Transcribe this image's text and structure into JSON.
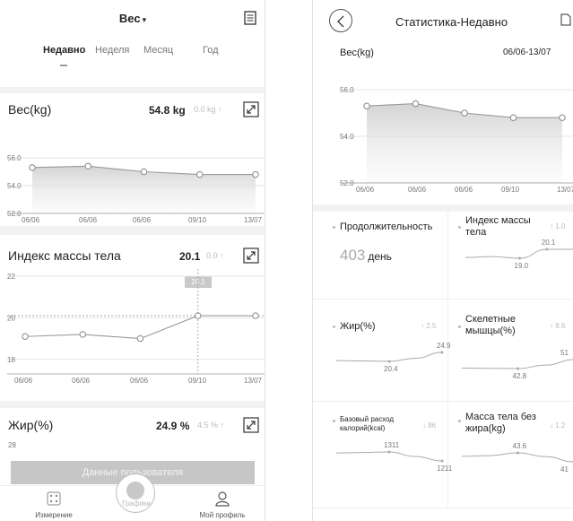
{
  "left": {
    "header": {
      "title": "Вес",
      "caret": "▾",
      "doc_icon": "document-icon"
    },
    "tabs": [
      {
        "label": "Недавно",
        "active": true
      },
      {
        "label": "Неделя",
        "active": false
      },
      {
        "label": "Месяц",
        "active": false
      },
      {
        "label": "Год",
        "active": false
      }
    ],
    "weight_card": {
      "title": "Вес(kg)",
      "value": "54.8 kg",
      "delta": "0.0 kg ↑",
      "expand_icon": "expand-icon"
    },
    "bmi_card": {
      "title": "Индекс массы тела",
      "value": "20.1",
      "delta": "0.0 ↑",
      "expand_icon": "expand-icon",
      "highlight": "20.1"
    },
    "fat_card": {
      "title": "Жир(%)",
      "value": "24.9 %",
      "delta": "4.5 % ↑",
      "expand_icon": "expand-icon",
      "ytick": "28"
    },
    "user_button": "Данные пользователя",
    "nav": [
      {
        "label": "Измерение",
        "icon": "measure-icon"
      },
      {
        "label": "Графики",
        "icon": "chart-icon"
      },
      {
        "label": "Мой профиль",
        "icon": "profile-icon"
      }
    ]
  },
  "right": {
    "header": {
      "title": "Статистика-Недавно",
      "back_icon": "back-icon",
      "edit_icon": "edit-icon"
    },
    "weight_label": "Вес(kg)",
    "date_range": "06/06-13/07",
    "duration": {
      "title": "Продолжительность",
      "value": "403",
      "unit": "день"
    },
    "bmi": {
      "title": "Индекс массы тела",
      "delta": "↑ 1.0",
      "min_label": "19.0",
      "max_label": "20.1"
    },
    "fat": {
      "title": "Жир(%)",
      "delta": "↑ 2.5",
      "min_label": "20.4",
      "max_label": "24.9"
    },
    "muscle": {
      "title": "Скелетные мышцы(%)",
      "delta": "↑ 8.6",
      "min_label": "42.8",
      "max_label": "51"
    },
    "bmr": {
      "title": "Базовый расход калорий(kcal)",
      "delta": "↓ 86",
      "max_label": "1311",
      "min_label": "1211"
    },
    "lean": {
      "title": "Масса тела без жира(kg)",
      "delta": "↓ 1.2",
      "max_label": "43.6",
      "min_label": "41"
    }
  },
  "chart_data": [
    {
      "type": "area",
      "title": "Вес(kg)",
      "categories": [
        "06/06",
        "06/06",
        "06/06",
        "09/10",
        "13/07"
      ],
      "values": [
        55.3,
        55.4,
        55.0,
        54.8,
        54.8
      ],
      "yticks": [
        "56.0",
        "54.0",
        "52.0"
      ],
      "ylim": [
        52,
        56
      ]
    },
    {
      "type": "line",
      "title": "Индекс массы тела",
      "categories": [
        "06/06",
        "06/06",
        "06/06",
        "09/10",
        "13/07"
      ],
      "values": [
        19.1,
        19.2,
        19.0,
        20.1,
        20.1
      ],
      "yticks": [
        "22",
        "20",
        "18"
      ],
      "ylim": [
        17.3,
        22
      ]
    },
    {
      "type": "area",
      "title": "Вес(kg)",
      "categories": [
        "06/06",
        "06/06",
        "06/06",
        "09/10",
        "13/07"
      ],
      "values": [
        55.3,
        55.4,
        55.0,
        54.8,
        54.8
      ],
      "yticks": [
        "56.0",
        "54.0",
        "52.0"
      ],
      "ylim": [
        52,
        56
      ]
    }
  ]
}
